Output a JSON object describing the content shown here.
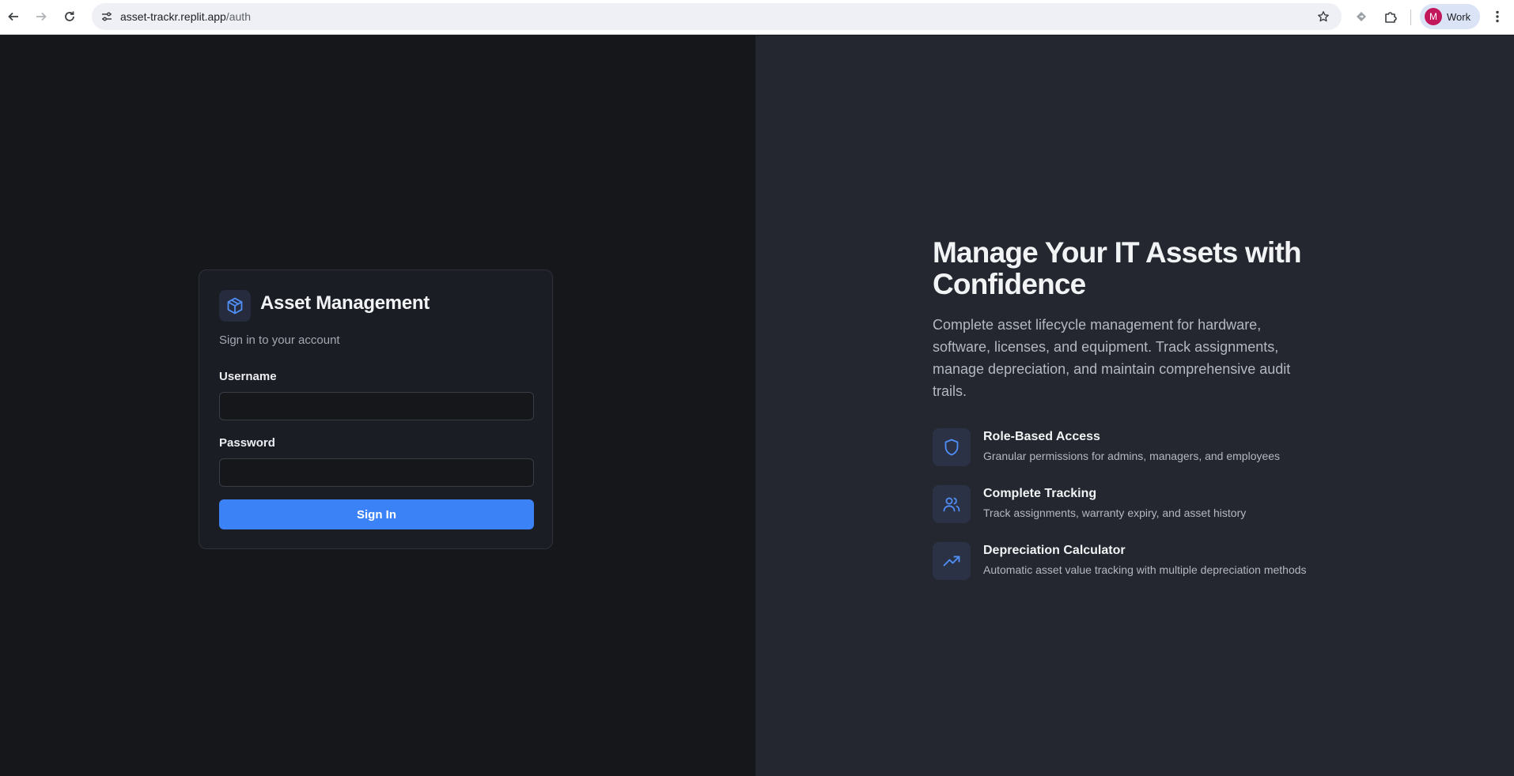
{
  "browser": {
    "url_host": "asset-trackr.replit.app",
    "url_path": "/auth",
    "profile_initial": "M",
    "profile_label": "Work"
  },
  "login_card": {
    "title": "Asset Management",
    "subtitle": "Sign in to your account",
    "username_label": "Username",
    "username_value": "",
    "password_label": "Password",
    "password_value": "",
    "submit_label": "Sign In"
  },
  "hero": {
    "title": "Manage Your IT Assets with Confidence",
    "description": "Complete asset lifecycle management for hardware, software, licenses, and equipment. Track assignments, manage depreciation, and maintain comprehensive audit trails.",
    "features": [
      {
        "icon": "shield-icon",
        "title": "Role-Based Access",
        "description": "Granular permissions for admins, managers, and employees"
      },
      {
        "icon": "users-icon",
        "title": "Complete Tracking",
        "description": "Track assignments, warranty expiry, and asset history"
      },
      {
        "icon": "trending-up-icon",
        "title": "Depreciation Calculator",
        "description": "Automatic asset value tracking with multiple depreciation methods"
      }
    ]
  },
  "colors": {
    "accent": "#3b82f6",
    "left_background": "#16171b",
    "right_background": "#24272f",
    "card_background": "#1b1d24"
  }
}
